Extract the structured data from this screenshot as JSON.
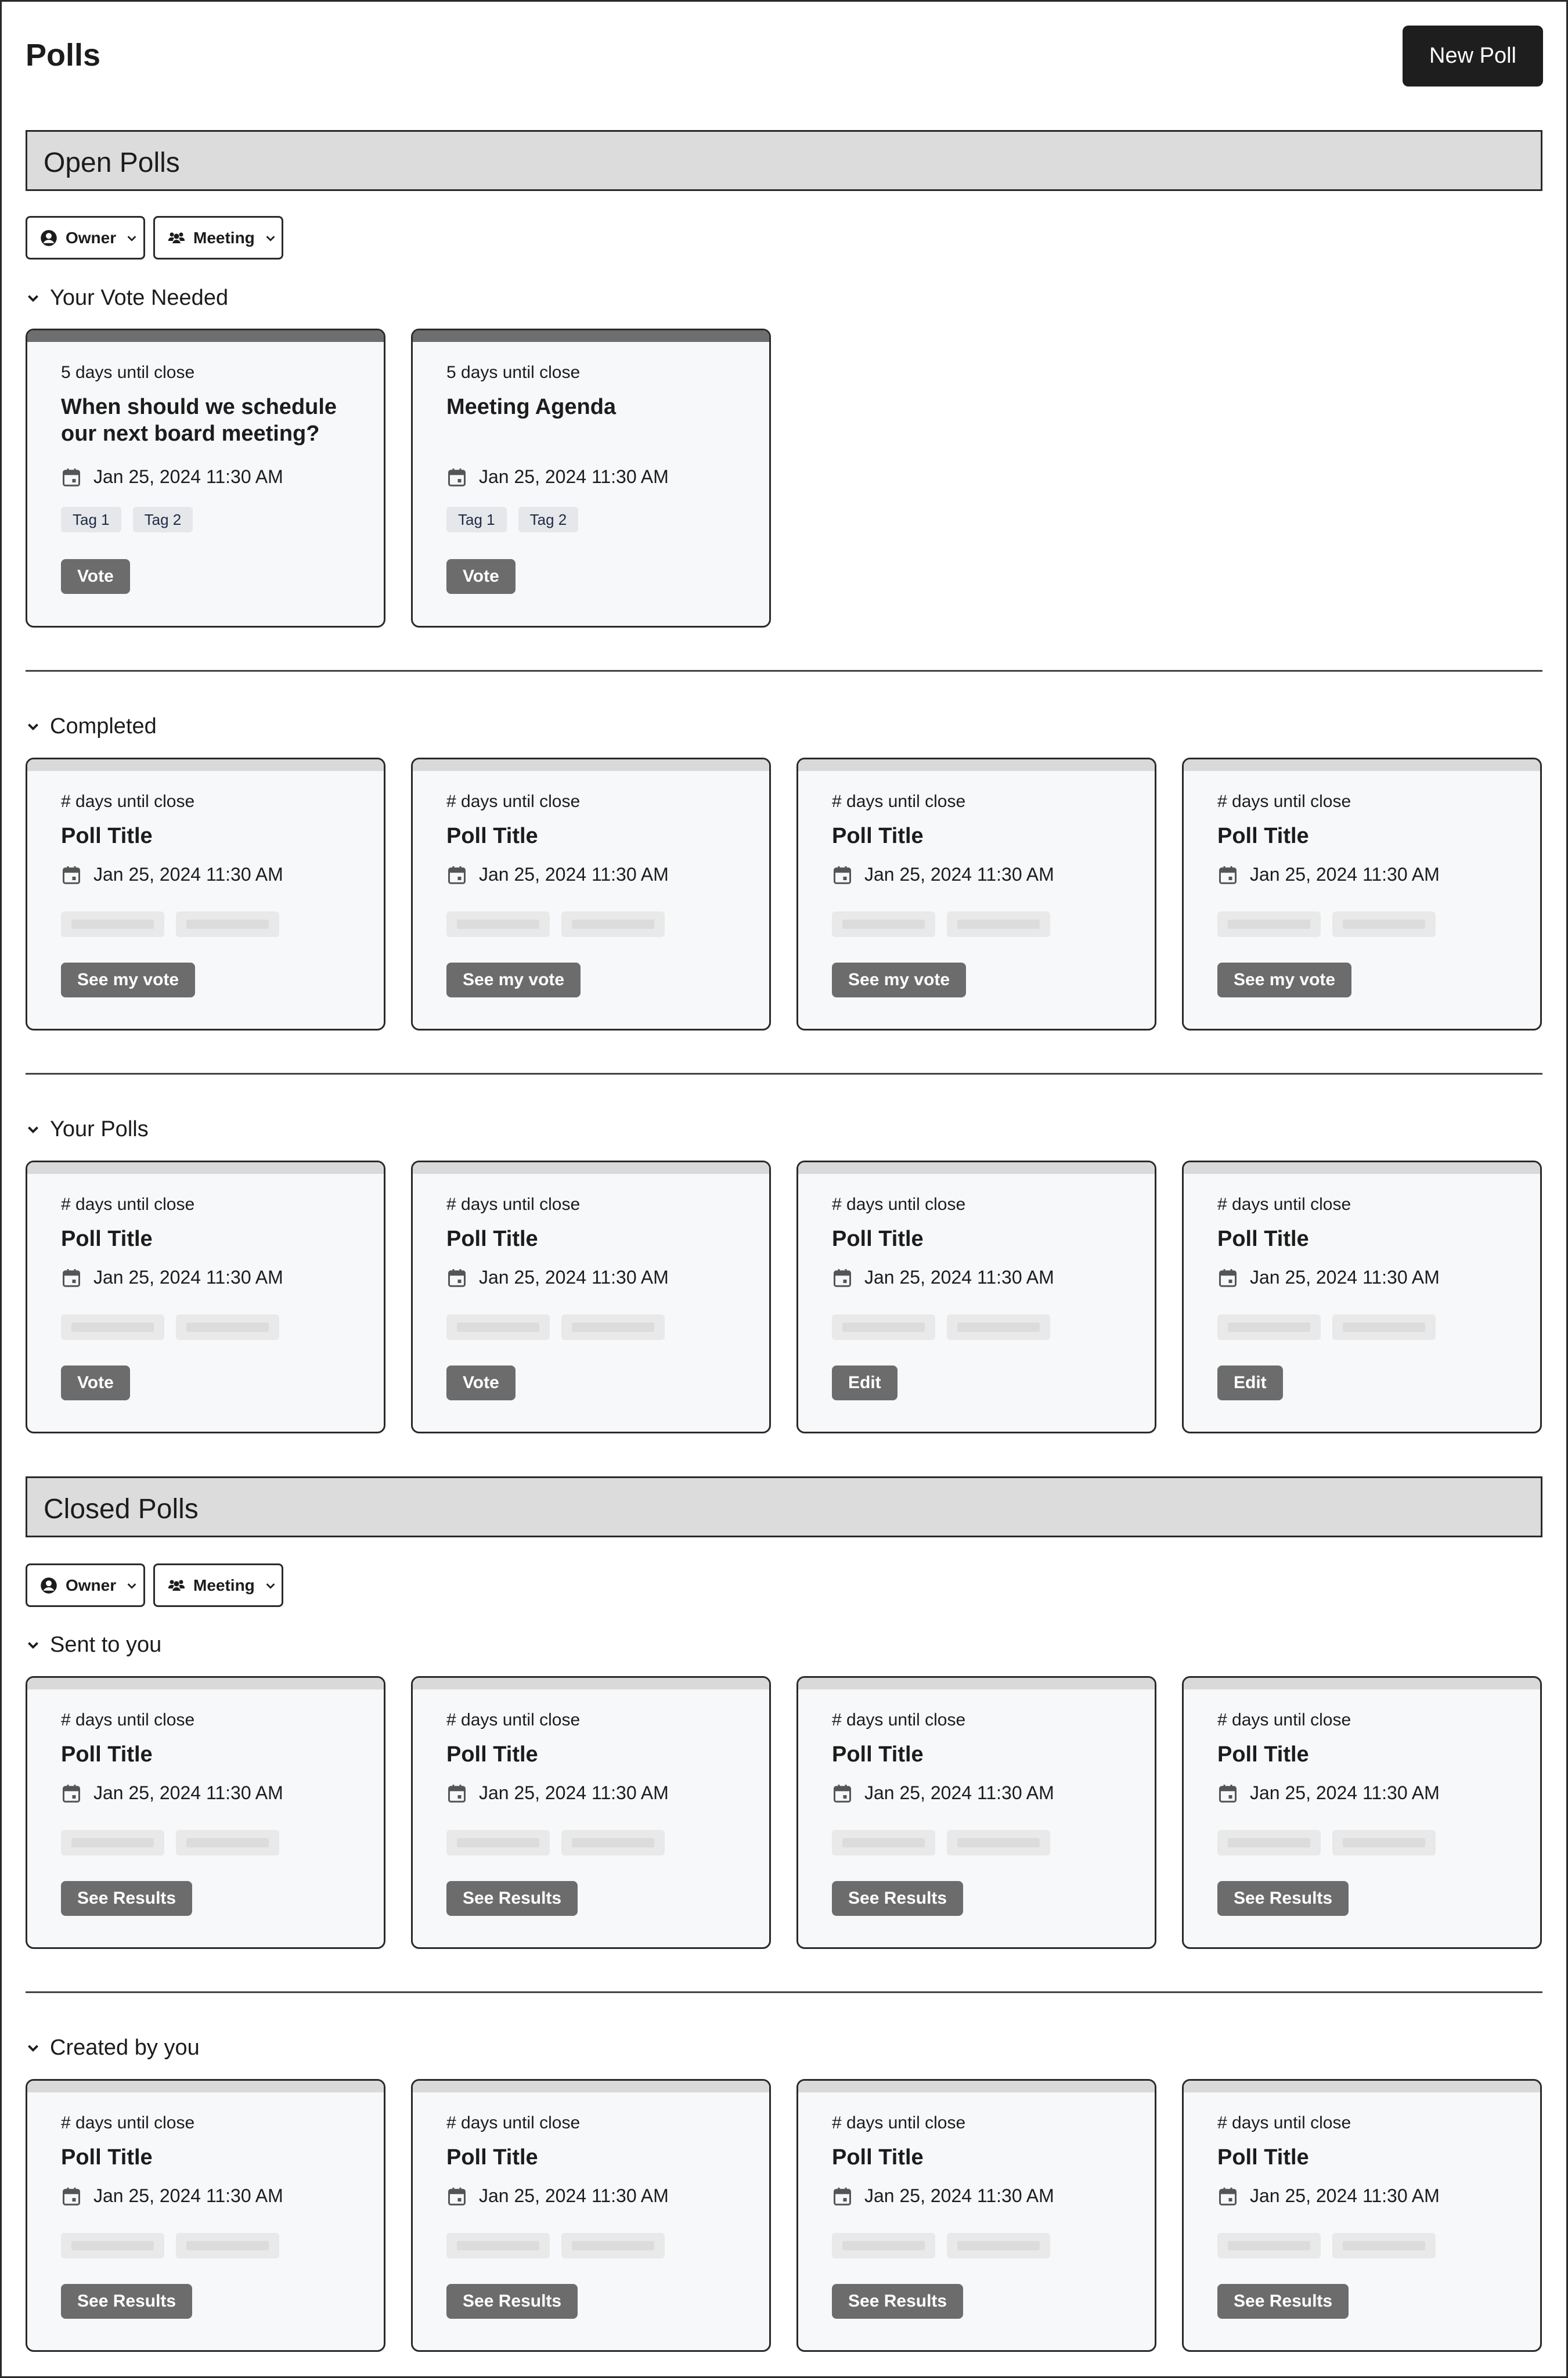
{
  "header": {
    "title": "Polls",
    "new_poll_label": "New Poll"
  },
  "filters": {
    "owner_label": "Owner",
    "meeting_label": "Meeting"
  },
  "open_polls": {
    "title": "Open Polls",
    "your_vote_needed": {
      "label": "Your Vote Needed",
      "cards": [
        {
          "meta": "5 days until close",
          "title": "When should we schedule our next board meeting?",
          "date": "Jan 25, 2024 11:30 AM",
          "tags": [
            "Tag 1",
            "Tag 2"
          ],
          "action": "Vote"
        },
        {
          "meta": "5 days until close",
          "title": "Meeting Agenda",
          "date": "Jan 25, 2024 11:30 AM",
          "tags": [
            "Tag 1",
            "Tag 2"
          ],
          "action": "Vote"
        }
      ]
    },
    "completed": {
      "label": "Completed",
      "cards": [
        {
          "meta": "# days until close",
          "title": "Poll Title",
          "date": "Jan 25, 2024 11:30 AM",
          "action": "See my vote"
        },
        {
          "meta": "# days until close",
          "title": "Poll Title",
          "date": "Jan 25, 2024 11:30 AM",
          "action": "See my vote"
        },
        {
          "meta": "# days until close",
          "title": "Poll Title",
          "date": "Jan 25, 2024 11:30 AM",
          "action": "See my vote"
        },
        {
          "meta": "# days until close",
          "title": "Poll Title",
          "date": "Jan 25, 2024 11:30 AM",
          "action": "See my vote"
        }
      ]
    },
    "your_polls": {
      "label": "Your Polls",
      "cards": [
        {
          "meta": "# days until close",
          "title": "Poll Title",
          "date": "Jan 25, 2024 11:30 AM",
          "action": "Vote"
        },
        {
          "meta": "# days until close",
          "title": "Poll Title",
          "date": "Jan 25, 2024 11:30 AM",
          "action": "Vote"
        },
        {
          "meta": "# days until close",
          "title": "Poll Title",
          "date": "Jan 25, 2024 11:30 AM",
          "action": "Edit"
        },
        {
          "meta": "# days until close",
          "title": "Poll Title",
          "date": "Jan 25, 2024 11:30 AM",
          "action": "Edit"
        }
      ]
    }
  },
  "closed_polls": {
    "title": "Closed Polls",
    "sent_to_you": {
      "label": "Sent to you",
      "cards": [
        {
          "meta": "# days until close",
          "title": "Poll Title",
          "date": "Jan 25, 2024 11:30 AM",
          "action": "See Results"
        },
        {
          "meta": "# days until close",
          "title": "Poll Title",
          "date": "Jan 25, 2024 11:30 AM",
          "action": "See Results"
        },
        {
          "meta": "# days until close",
          "title": "Poll Title",
          "date": "Jan 25, 2024 11:30 AM",
          "action": "See Results"
        },
        {
          "meta": "# days until close",
          "title": "Poll Title",
          "date": "Jan 25, 2024 11:30 AM",
          "action": "See Results"
        }
      ]
    },
    "created_by_you": {
      "label": "Created by you",
      "cards": [
        {
          "meta": "# days until close",
          "title": "Poll Title",
          "date": "Jan 25, 2024 11:30 AM",
          "action": "See Results"
        },
        {
          "meta": "# days until close",
          "title": "Poll Title",
          "date": "Jan 25, 2024 11:30 AM",
          "action": "See Results"
        },
        {
          "meta": "# days until close",
          "title": "Poll Title",
          "date": "Jan 25, 2024 11:30 AM",
          "action": "See Results"
        },
        {
          "meta": "# days until close",
          "title": "Poll Title",
          "date": "Jan 25, 2024 11:30 AM",
          "action": "See Results"
        }
      ]
    }
  }
}
